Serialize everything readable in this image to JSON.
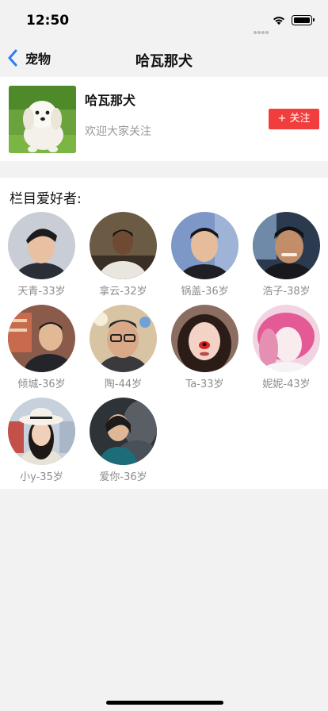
{
  "status_bar": {
    "time": "12:50"
  },
  "nav": {
    "back_label": "宠物",
    "title": "哈瓦那犬"
  },
  "profile": {
    "name": "哈瓦那犬",
    "description": "欢迎大家关注",
    "follow_label": "+ 关注",
    "image_icon": "white-dog-photo"
  },
  "fans": {
    "title": "栏目爱好者:",
    "items": [
      {
        "label": "天青-33岁"
      },
      {
        "label": "拿云-32岁"
      },
      {
        "label": "锅盖-36岁"
      },
      {
        "label": "浩子-38岁"
      },
      {
        "label": "倾城-36岁"
      },
      {
        "label": "陶-44岁"
      },
      {
        "label": "Ta-33岁"
      },
      {
        "label": "妮妮-43岁"
      },
      {
        "label": "小y-35岁"
      },
      {
        "label": "爱你-36岁"
      }
    ]
  },
  "colors": {
    "accent_blue": "#2f7cf6",
    "follow_red": "#f23d3d",
    "page_background": "#f2f2f2"
  }
}
